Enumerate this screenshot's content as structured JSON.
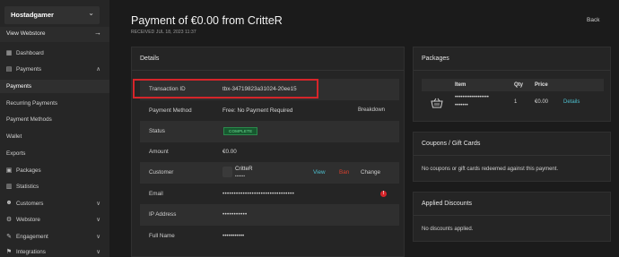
{
  "sidebar": {
    "store_name": "Hostadgamer",
    "view_webstore": "View Webstore",
    "items": [
      {
        "icon": "dashboard-icon",
        "glyph": "▦",
        "label": "Dashboard"
      },
      {
        "icon": "payments-icon",
        "glyph": "▤",
        "label": "Payments",
        "caret": "∧"
      }
    ],
    "sub_items": [
      "Payments",
      "Recurring Payments",
      "Payment Methods",
      "Wallet",
      "Exports"
    ],
    "items2": [
      {
        "icon": "packages-icon",
        "glyph": "▣",
        "label": "Packages",
        "caret": ""
      },
      {
        "icon": "statistics-icon",
        "glyph": "▥",
        "label": "Statistics",
        "caret": ""
      },
      {
        "icon": "customers-icon",
        "glyph": "☻",
        "label": "Customers",
        "caret": "∨"
      },
      {
        "icon": "webstore-icon",
        "glyph": "⚙",
        "label": "Webstore",
        "caret": "∨"
      },
      {
        "icon": "engagement-icon",
        "glyph": "✎",
        "label": "Engagement",
        "caret": "∨"
      },
      {
        "icon": "integrations-icon",
        "glyph": "⚑",
        "label": "Integrations",
        "caret": "∨"
      }
    ]
  },
  "header": {
    "title": "Payment of €0.00 from CritteR",
    "received": "RECEIVED JUL 18, 2023 11:37",
    "back": "Back"
  },
  "details": {
    "title": "Details",
    "rows": {
      "transaction": {
        "key": "Transaction ID",
        "value": "tbx-34719823a31024-20ee15"
      },
      "method": {
        "key": "Payment Method",
        "value": "Free: No Payment Required",
        "extra": "Breakdown"
      },
      "status": {
        "key": "Status",
        "value": "COMPLETE"
      },
      "amount": {
        "key": "Amount",
        "value": "€0.00"
      },
      "customer": {
        "key": "Customer",
        "name": "CritteR",
        "sub": "••••••",
        "view": "View",
        "ban": "Ban",
        "change": "Change"
      },
      "email": {
        "key": "Email",
        "value": "••••••••••••••••••••••••••••••••",
        "alert": "!"
      },
      "ip": {
        "key": "IP Address",
        "value": "•••••••••••"
      },
      "fullname": {
        "key": "Full Name",
        "value": "•••••••••••"
      }
    }
  },
  "packages": {
    "title": "Packages",
    "columns": [
      "Item",
      "Qty",
      "Price"
    ],
    "row": {
      "item_line1": "••••••••••••••••••",
      "item_line2": "•••••••",
      "qty": "1",
      "price": "€0.00",
      "action": "Details"
    }
  },
  "coupons": {
    "title": "Coupons / Gift Cards",
    "text": "No coupons or gift cards redeemed against this payment."
  },
  "discounts": {
    "title": "Applied Discounts",
    "text": "No discounts applied."
  }
}
